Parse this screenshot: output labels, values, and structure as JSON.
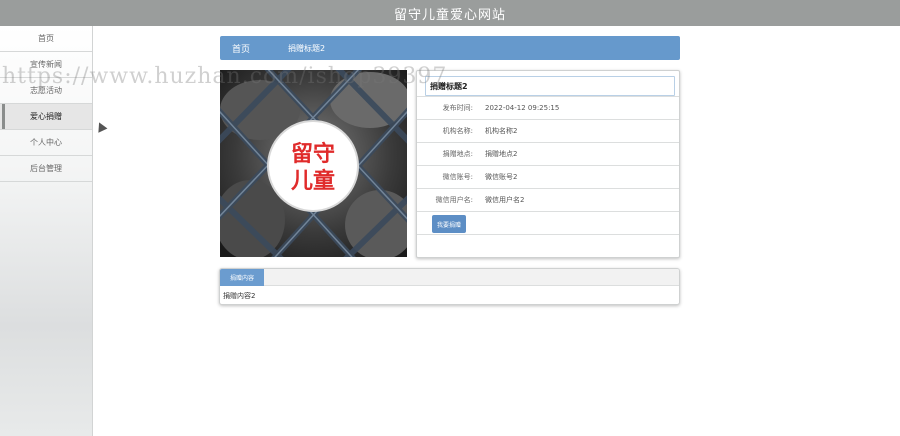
{
  "header": {
    "title": "留守儿童爱心网站"
  },
  "sidebar": {
    "items": [
      {
        "label": "首页"
      },
      {
        "label": "宣传新闻"
      },
      {
        "label": "志愿活动"
      },
      {
        "label": "爱心捐赠"
      },
      {
        "label": "个人中心"
      },
      {
        "label": "后台管理"
      }
    ]
  },
  "breadcrumb": {
    "home": "首页",
    "current": "捐赠标题2"
  },
  "poster": {
    "line1": "留守",
    "line2": "儿童"
  },
  "detail": {
    "title": "捐赠标题2",
    "rows": [
      {
        "label": "发布时间:",
        "value": "2022-04-12 09:25:15"
      },
      {
        "label": "机构名称:",
        "value": "机构名称2"
      },
      {
        "label": "捐赠地点:",
        "value": "捐赠地点2"
      },
      {
        "label": "微信账号:",
        "value": "微信账号2"
      },
      {
        "label": "微信用户名:",
        "value": "微信用户名2"
      }
    ],
    "button_label": "我要捐赠"
  },
  "content": {
    "tab_label": "捐赠内容",
    "body": "捐赠内容2"
  },
  "watermark": "https://www.huzhan.com/ishop39397",
  "colors": {
    "topbar": "#9a9d9c",
    "accent": "#6699cc",
    "poster_red": "#e02b2b"
  }
}
